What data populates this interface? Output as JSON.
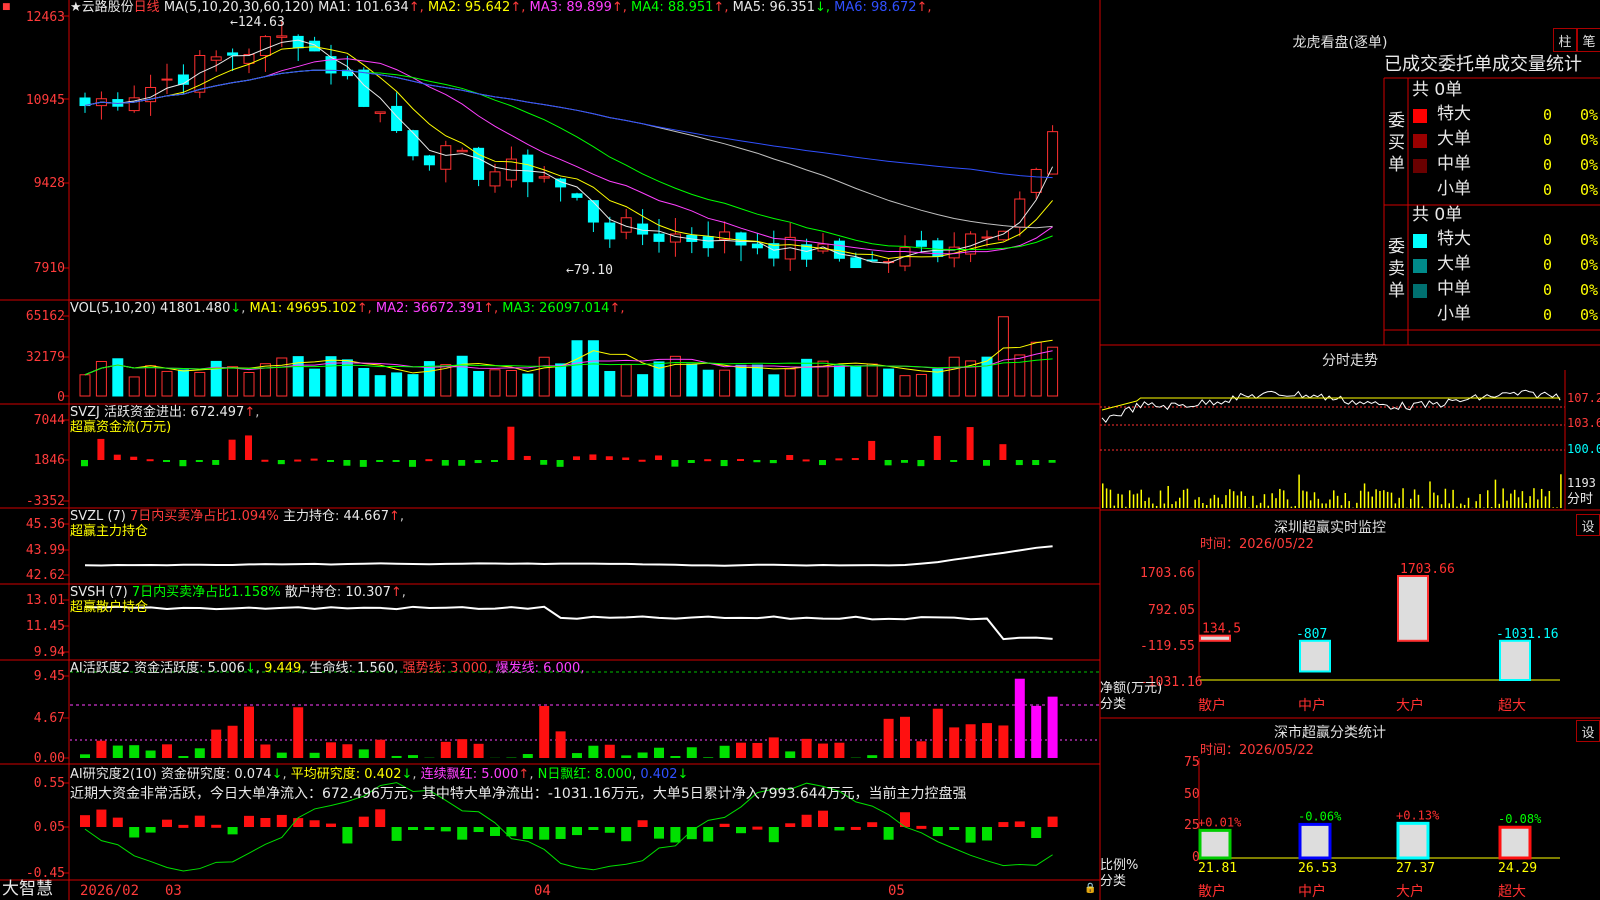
{
  "app": {
    "name": "大智慧"
  },
  "stock": {
    "name": "★云路股份",
    "period": "日线"
  },
  "main": {
    "ma_label": "MA(5,10,20,30,60,120)",
    "ma_values": [
      {
        "name": "MA1",
        "value": "101.634",
        "dir": "↑",
        "color": "#e8e8e8"
      },
      {
        "name": "MA2",
        "value": "95.642",
        "dir": "↑",
        "color": "#ffff00"
      },
      {
        "name": "MA3",
        "value": "89.899",
        "dir": "↑",
        "color": "#ff40ff"
      },
      {
        "name": "MA4",
        "value": "88.951",
        "dir": "↑",
        "color": "#00ff00"
      },
      {
        "name": "MA5",
        "value": "96.351",
        "dir": "↓",
        "color": "#e8e8e8"
      },
      {
        "name": "MA6",
        "value": "98.672",
        "dir": "↑",
        "color": "#3050ff"
      }
    ],
    "y_ticks": [
      "12463",
      "10945",
      "9428",
      "7910"
    ],
    "high_label": "124.63",
    "low_label": "←79.10"
  },
  "vol": {
    "label": "VOL(5,10,20)",
    "value": "41801.480",
    "dir": "↓",
    "ma": [
      {
        "name": "MA1",
        "value": "49695.102",
        "dir": "↑",
        "color": "#ffff00"
      },
      {
        "name": "MA2",
        "value": "36672.391",
        "dir": "↑",
        "color": "#ff40ff"
      },
      {
        "name": "MA3",
        "value": "26097.014",
        "dir": "↑",
        "color": "#00ff00"
      }
    ],
    "y_ticks": [
      "65162",
      "32179",
      "0"
    ]
  },
  "svzj": {
    "label": "SVZJ  活跃资金进出",
    "value": "672.497",
    "dir": "↑",
    "sub": "超赢资金流(万元)",
    "y_ticks": [
      "7044",
      "1846",
      "-3352"
    ]
  },
  "svzl": {
    "label": "SVZL (7)",
    "pct": "7日内买卖净占比1.094%",
    "hold_label": "主力持仓",
    "hold_value": "44.667",
    "dir": "↑",
    "sub": "超赢主力持仓",
    "y_ticks": [
      "45.36",
      "43.99",
      "42.62"
    ]
  },
  "svsh": {
    "label": "SVSH (7)",
    "pct": "7日内买卖净占比1.158%",
    "hold_label": "散户持仓",
    "hold_value": "10.307",
    "dir": "↑",
    "sub": "超赢散户持仓",
    "y_ticks": [
      "13.01",
      "11.45",
      "9.94"
    ]
  },
  "ai1": {
    "label": "AI活跃度2",
    "t1": "资金活跃度",
    "v1": "5.006",
    "d1": "↓",
    "v2": "9.449",
    "t3": "生命线",
    "v3": "1.560",
    "t4": "强势线",
    "v4": "3.000",
    "t5": "爆发线",
    "v5": "6.000",
    "y_ticks": [
      "9.45",
      "4.67",
      "0.00"
    ]
  },
  "ai2": {
    "label": "AI研究度2(10)",
    "t1": "资金研究度",
    "v1": "0.074",
    "d1": "↓",
    "t2": "平均研究度",
    "v2": "0.402",
    "d2": "↓",
    "t3": "连续飘红",
    "v3": "5.000",
    "d3": "↑",
    "t4": "N日飘红",
    "v4": "8.000",
    "v5": "0.402",
    "d5": "↓",
    "note": "近期大资金非常活跃，今日大单净流入：672.496万元，其中特大单净流出：-1031.16万元，大单5日累计净入7993.644万元，当前主力控盘强",
    "y_ticks": [
      "0.55",
      "0.05",
      "-0.45"
    ]
  },
  "xaxis": {
    "labels": [
      "2026/02",
      "03",
      "04",
      "05"
    ]
  },
  "lhb": {
    "title": "龙虎看盘(逐单)",
    "btn1": "柱",
    "btn2": "笔",
    "tabs": "已成交委托单成交量统计",
    "buy_label": "委买单",
    "sell_label": "委卖单",
    "buy_total": "共 0单",
    "sell_total": "共 0单",
    "buy_rows": [
      {
        "name": "特大",
        "n": "0",
        "p": "0%",
        "color": "#ff0000"
      },
      {
        "name": "大单",
        "n": "0",
        "p": "0%",
        "color": "#9a0000"
      },
      {
        "name": "中单",
        "n": "0",
        "p": "0%",
        "color": "#6a0000"
      },
      {
        "name": "小单",
        "n": "0",
        "p": "0%",
        "color": ""
      }
    ],
    "sell_rows": [
      {
        "name": "特大",
        "n": "0",
        "p": "0%",
        "color": "#00ffff"
      },
      {
        "name": "大单",
        "n": "0",
        "p": "0%",
        "color": "#008a8a"
      },
      {
        "name": "中单",
        "n": "0",
        "p": "0%",
        "color": "#007070"
      },
      {
        "name": "小单",
        "n": "0",
        "p": "0%",
        "color": ""
      }
    ]
  },
  "fenshi": {
    "title": "分时走势",
    "right_ticks": [
      "107.2",
      "103.6",
      "100.0",
      "1193"
    ],
    "right_bottom": "分时"
  },
  "sz_monitor": {
    "title": "深圳超赢实时监控",
    "btn": "设",
    "time": "时间：2026/05/22",
    "y_ticks": [
      "1703.66",
      "792.05",
      "-119.55",
      "-1031.16"
    ],
    "axis_note": "净额(万元)",
    "axis_note2": "分类",
    "categories": [
      "散户",
      "中户",
      "大户",
      "超大"
    ],
    "values": [
      134.5,
      -807,
      1703.66,
      -1031.16
    ],
    "value_labels": [
      "134.5",
      "-807",
      "1703.66",
      "-1031.16"
    ]
  },
  "sz_class": {
    "title": "深市超赢分类统计",
    "btn": "设",
    "time": "时间：2026/05/22",
    "y_ticks": [
      "75",
      "50",
      "25",
      "0"
    ],
    "axis_note": "比例%",
    "axis_note2": "分类",
    "categories": [
      "散户",
      "中户",
      "大户",
      "超大"
    ],
    "values": [
      21.81,
      26.53,
      27.37,
      24.29
    ],
    "changes": [
      "+0.01%",
      "-0.06%",
      "+0.13%",
      "-0.08%"
    ]
  }
}
